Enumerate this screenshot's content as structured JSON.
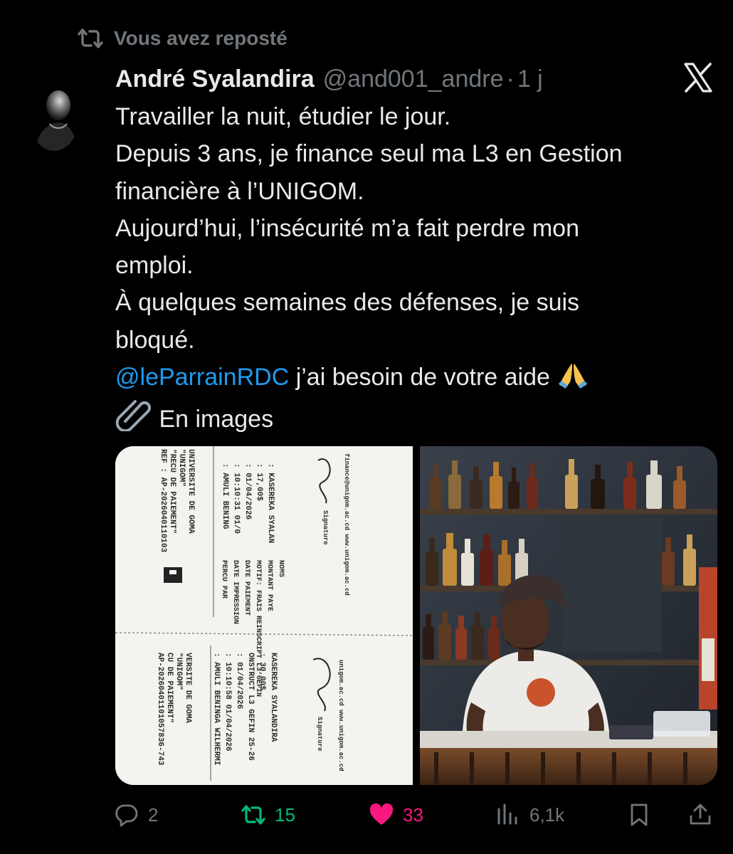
{
  "repost": {
    "label": "Vous avez reposté"
  },
  "author": {
    "name": "André Syalandira",
    "handle": "@and001_andre",
    "separator": "·",
    "time": "1 j"
  },
  "tweet": {
    "lines": [
      "Travailler la nuit, étudier le jour.",
      "Depuis 3 ans, je finance seul ma L3 en Gestion",
      "financière à l’UNIGOM.",
      "Aujourd’hui, l’insécurité m’a fait perdre mon",
      "emploi.",
      "À quelques semaines des défenses, je suis",
      "bloqué."
    ],
    "mention": "@leParrainRDC",
    "mention_suffix": " j’ai besoin de votre aide ",
    "attachment_label": "En images"
  },
  "receipts": {
    "top": {
      "heading": [
        "UNIVERSITE DE GOMA",
        "\"UNIGOM\"",
        "\"RECU DE PAIEMENT\"",
        "REF : AP-2026040110103"
      ],
      "fields": [
        "NOMS",
        "MONTANT PAYE",
        "MOTIF: FRAIS REINSCRIPT L3 GEFIN",
        "DATE PAIEMENT",
        "DATE IMPRESSION",
        "PERCU PAR"
      ],
      "values": [
        ": KASEREKA SYALAN",
        ": 17,00$",
        "",
        ": 01/04/2026",
        ": 10:10:31 01/0",
        ": AMULI BENING"
      ],
      "signature": "Signature",
      "footer": "finance@unigom.ac.cd    www.unigom.ac.cd"
    },
    "bottom": {
      "heading": [
        "VERSITE DE GOMA",
        "\"UNIGOM\"",
        "CU DE PAIEMENT\"",
        "AP-20260401101057836-743"
      ],
      "values": [
        "KASEREKA SYALANDIRA",
        ": 30,00$",
        "ONSTRUCT L3 GEFIN 25-26",
        ": 01/04/2026",
        ": 10:10:58 01/04/2026",
        ": AMULI BENINGA WILHERMI"
      ],
      "signature": "Signature",
      "footer": "unigom.ac.cd    www.unigom.ac.cd"
    }
  },
  "actions": {
    "replies": "2",
    "reposts": "15",
    "likes": "33",
    "views": "6,1k"
  },
  "colors": {
    "background": "#000000",
    "text": "#e7e9ea",
    "muted": "#71767b",
    "link": "#1d9bf0",
    "repost_active": "#00ba7c",
    "like_active": "#f91880"
  }
}
